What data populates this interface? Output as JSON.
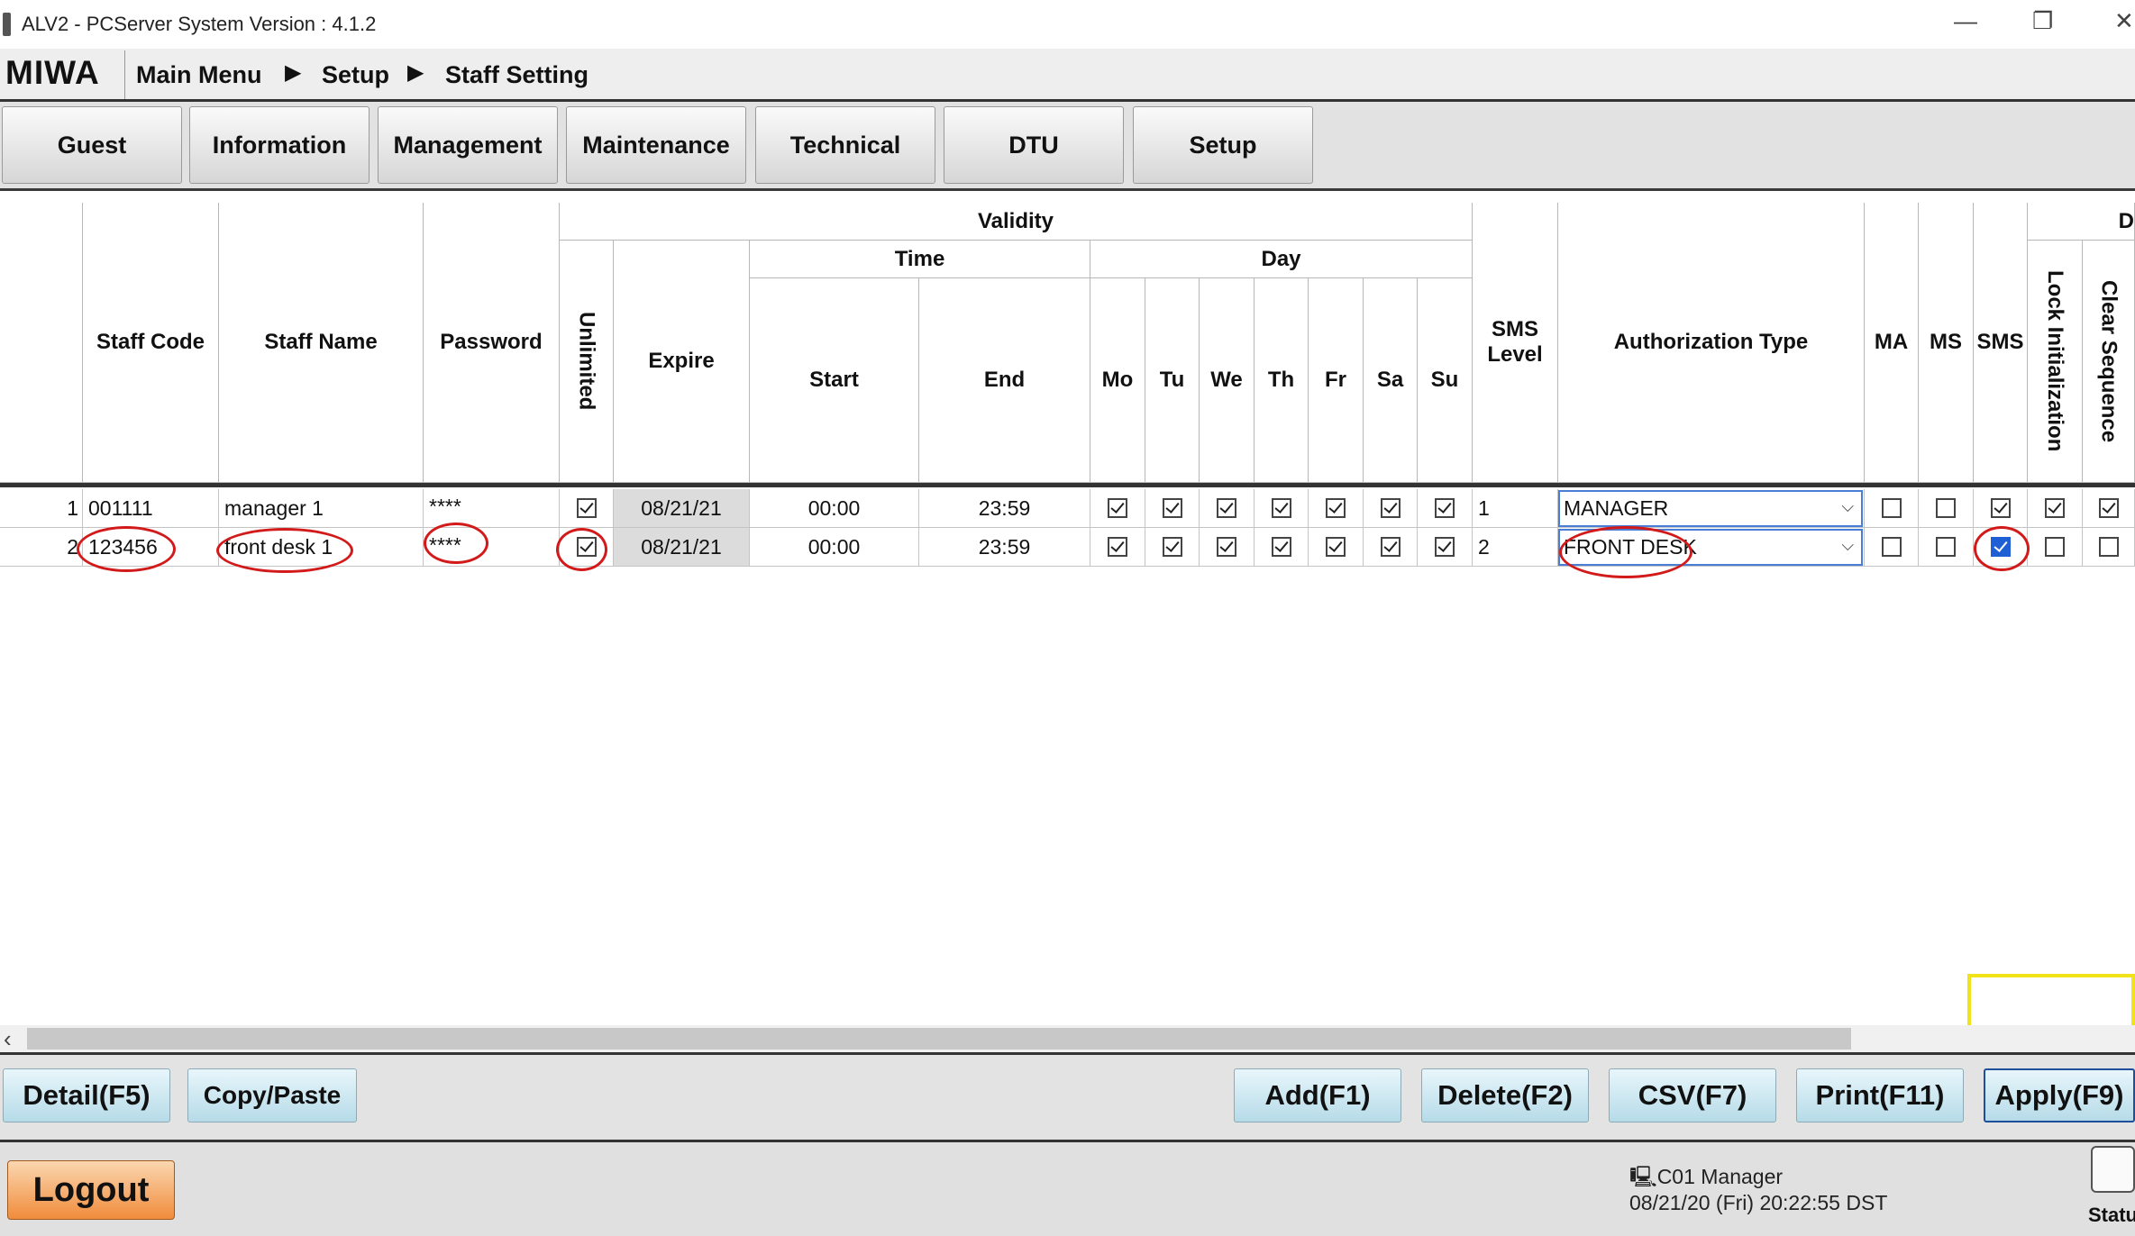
{
  "window": {
    "title": "ALV2 - PCServer System Version : 4.1.2",
    "minimize": "—",
    "restore": "❐",
    "close": "✕"
  },
  "breadcrumb": {
    "logo": "MIWA",
    "arrow": "▶",
    "items": [
      "Main Menu",
      "Setup",
      "Staff Setting"
    ]
  },
  "tabs": [
    "Guest",
    "Information",
    "Management",
    "Maintenance",
    "Technical",
    "DTU",
    "Setup"
  ],
  "grid": {
    "headers": {
      "staff_code": "Staff Code",
      "staff_name": "Staff Name",
      "password": "Password",
      "validity": "Validity",
      "unlimited": "Unlimited",
      "expire": "Expire",
      "time": "Time",
      "start": "Start",
      "end": "End",
      "day": "Day",
      "days": [
        "Mo",
        "Tu",
        "We",
        "Th",
        "Fr",
        "Sa",
        "Su"
      ],
      "sms_level": "SMS Level",
      "auth_type": "Authorization Type",
      "ma": "MA",
      "ms": "MS",
      "sms": "SMS",
      "lock_init": "Lock Initialization",
      "clear_seq": "Clear Sequence",
      "next_group": "D"
    },
    "rows": [
      {
        "no": "1",
        "staff_code": "001111",
        "staff_name": "manager 1",
        "password": "****",
        "unlimited": true,
        "expire": "08/21/21",
        "start": "00:00",
        "end": "23:59",
        "days": [
          true,
          true,
          true,
          true,
          true,
          true,
          true
        ],
        "sms_level": "1",
        "auth_type": "MANAGER",
        "ma": false,
        "ms": false,
        "sms": true,
        "lock_init": true,
        "clear_seq": true
      },
      {
        "no": "2",
        "staff_code": "123456",
        "staff_name": "front desk 1",
        "password": "****",
        "unlimited": true,
        "expire": "08/21/21",
        "start": "00:00",
        "end": "23:59",
        "days": [
          true,
          true,
          true,
          true,
          true,
          true,
          true
        ],
        "sms_level": "2",
        "auth_type": "FRONT DESK",
        "ma": false,
        "ms": false,
        "sms": true,
        "lock_init": false,
        "clear_seq": false
      }
    ]
  },
  "scrollbar": {
    "left_arrow": "‹"
  },
  "buttons": {
    "detail": "Detail(F5)",
    "copy_paste": "Copy/Paste",
    "add": "Add(F1)",
    "delete": "Delete(F2)",
    "csv": "CSV(F7)",
    "print": "Print(F11)",
    "apply": "Apply(F9)"
  },
  "status": {
    "logout": "Logout",
    "terminal": "C01 Manager",
    "datetime": "08/21/20 (Fri) 20:22:55 DST",
    "status_label": "Statu"
  },
  "colors": {
    "annotation_red": "#d21a1a",
    "highlight_yellow": "#f0e31a",
    "selected_blue": "#1f5fd6"
  }
}
